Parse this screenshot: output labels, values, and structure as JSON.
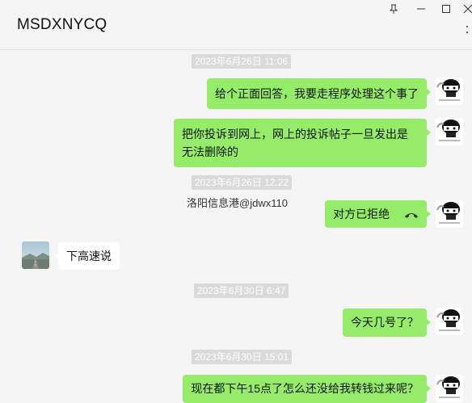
{
  "window": {
    "title": "MSDXNYCQ"
  },
  "messages": [
    {
      "type": "timestamp",
      "text": "2023年6月26日 11:06"
    },
    {
      "type": "outgoing",
      "text": "给个正面回答，我要走程序处理这个事了"
    },
    {
      "type": "outgoing",
      "text": "把你投诉到网上，网上的投诉帖子一旦发出是无法删除的"
    },
    {
      "type": "timestamp",
      "text": "2023年6月26日 12:22"
    },
    {
      "type": "outgoing",
      "sender_label": "洛阳信息港@jdwx110",
      "text": "对方已拒绝",
      "icon": "hangup-phone-icon"
    },
    {
      "type": "incoming",
      "text": "下高速说"
    },
    {
      "type": "timestamp",
      "text": "2023年6月30日 6:47"
    },
    {
      "type": "outgoing",
      "text": "今天几号了？"
    },
    {
      "type": "timestamp",
      "text": "2023年6月30日 15:01"
    },
    {
      "type": "outgoing",
      "text": "现在都下午15点了怎么还没给我转钱过来呢？"
    }
  ],
  "colors": {
    "outgoing_bubble": "#95ec69",
    "incoming_bubble": "#ffffff",
    "background": "#f5f5f5",
    "timestamp_bg": "#dadada"
  }
}
